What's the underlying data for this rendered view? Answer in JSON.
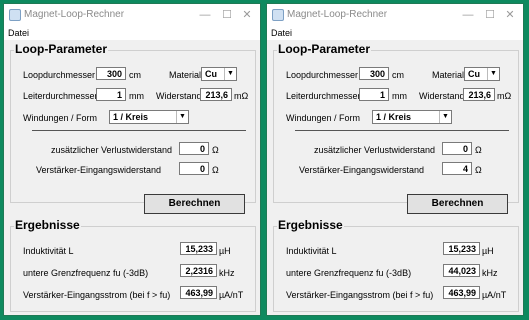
{
  "windows": [
    {
      "title": "Magnet-Loop-Rechner",
      "menu": {
        "file": "Datei"
      },
      "loop": {
        "heading": "Loop-Parameter",
        "diameter_label": "Loopdurchmesser",
        "diameter_value": "300",
        "diameter_unit": "cm",
        "material_label": "Material",
        "material_value": "Cu",
        "conductor_label": "Leiterdurchmesser",
        "conductor_value": "1",
        "conductor_unit": "mm",
        "resistance_label": "Widerstand",
        "resistance_value": "213,6",
        "resistance_unit": "mΩ",
        "windings_label": "Windungen / Form",
        "windings_value": "1 / Kreis",
        "extra_loss_label": "zusätzlicher Verlustwiderstand",
        "extra_loss_value": "0",
        "extra_loss_unit": "Ω",
        "amp_input_label": "Verstärker-Eingangswiderstand",
        "amp_input_value": "0",
        "amp_input_unit": "Ω"
      },
      "calc_button": "Berechnen",
      "results": {
        "heading": "Ergebnisse",
        "inductance_label": "Induktivität  L",
        "inductance_value": "15,233",
        "inductance_unit": "µH",
        "cutoff_label": "untere Grenzfrequenz  fu (-3dB)",
        "cutoff_value": "2,2316",
        "cutoff_unit": "kHz",
        "current_label": "Verstärker-Eingangsstrom  (bei f > fu)",
        "current_value": "463,99",
        "current_unit": "µA/nT"
      }
    },
    {
      "title": "Magnet-Loop-Rechner",
      "menu": {
        "file": "Datei"
      },
      "loop": {
        "heading": "Loop-Parameter",
        "diameter_label": "Loopdurchmesser",
        "diameter_value": "300",
        "diameter_unit": "cm",
        "material_label": "Material",
        "material_value": "Cu",
        "conductor_label": "Leiterdurchmesser",
        "conductor_value": "1",
        "conductor_unit": "mm",
        "resistance_label": "Widerstand",
        "resistance_value": "213,6",
        "resistance_unit": "mΩ",
        "windings_label": "Windungen / Form",
        "windings_value": "1 / Kreis",
        "extra_loss_label": "zusätzlicher Verlustwiderstand",
        "extra_loss_value": "0",
        "extra_loss_unit": "Ω",
        "amp_input_label": "Verstärker-Eingangswiderstand",
        "amp_input_value": "4",
        "amp_input_unit": "Ω"
      },
      "calc_button": "Berechnen",
      "results": {
        "heading": "Ergebnisse",
        "inductance_label": "Induktivität  L",
        "inductance_value": "15,233",
        "inductance_unit": "µH",
        "cutoff_label": "untere Grenzfrequenz  fu (-3dB)",
        "cutoff_value": "44,023",
        "cutoff_unit": "kHz",
        "current_label": "Verstärker-Eingangsstrom  (bei f > fu)",
        "current_value": "463,99",
        "current_unit": "µA/nT"
      }
    }
  ]
}
